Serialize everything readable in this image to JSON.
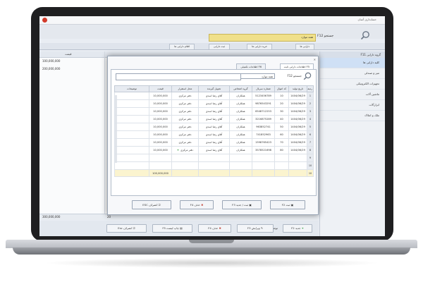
{
  "app": {
    "title": "حسابداری آسان"
  },
  "toolbar": {
    "search_label": "جستجو F12",
    "search_value": "همه موارد"
  },
  "main_tabs": [
    "اقلام دارایی ها",
    "ثبت دارایی",
    "خرید دارایی ها",
    "دارایی ها"
  ],
  "sidebar": {
    "header": "گروه دارایی F11",
    "items": [
      "کلیه دارایی ها",
      "میز و صندلی",
      "تجهیزات الکترونیکی",
      "ماشین آلات",
      "ابزارآلات",
      "ملک و املاک"
    ]
  },
  "background_grid": {
    "price_header": "قیمت",
    "values": [
      "100,000,000",
      "200,000,000"
    ],
    "total": "300,000,000",
    "total_count": "20",
    "description_label": "توضیحات :"
  },
  "background_buttons": {
    "new": "جدید F2",
    "edit": "ویرایش F3",
    "delete": "حذف F4",
    "print": "چاپ لیست F5",
    "cancel": "انصراف Esc"
  },
  "dialog": {
    "tabs": [
      "F5 اطلاعات دارایی ثابت",
      "F6 اطلاعات تکمیلی"
    ],
    "search_label": "جستجو F12",
    "search_scope": "همه موارد",
    "columns": [
      "ردیف",
      "تاریخ تولید",
      "کد اموال",
      "شماره سریال",
      "گروه اشخاص",
      "تحویل گیرنده",
      "محل استقرار",
      "قیمت",
      "توضیحات"
    ],
    "rows": [
      {
        "num": "1",
        "date": "1404/06/29",
        "code": "10",
        "serial": "5123456789",
        "group": "همکاران",
        "receiver": "آقای رضا اسدی",
        "location": "دفتر مرکزی",
        "price": "10,000,000",
        "desc": ""
      },
      {
        "num": "2",
        "date": "1404/06/29",
        "code": "20",
        "serial": "9876543291",
        "group": "همکاران",
        "receiver": "آقای رضا اسدی",
        "location": "دفتر مرکزی",
        "price": "10,000,000",
        "desc": ""
      },
      {
        "num": "3",
        "date": "1404/06/29",
        "code": "30",
        "serial": "6548712253",
        "group": "همکاران",
        "receiver": "آقای رضا اسدی",
        "location": "دفتر مرکزی",
        "price": "10,000,000",
        "desc": ""
      },
      {
        "num": "4",
        "date": "1404/06/29",
        "code": "40",
        "serial": "3216875289",
        "group": "همکاران",
        "receiver": "آقای رضا اسدی",
        "location": "دفتر مرکزی",
        "price": "10,000,000",
        "desc": ""
      },
      {
        "num": "5",
        "date": "1404/06/29",
        "code": "50",
        "serial": "963852741",
        "group": "همکاران",
        "receiver": "آقای رضا اسدی",
        "location": "دفتر مرکزی",
        "price": "10,000,000",
        "desc": ""
      },
      {
        "num": "6",
        "date": "1404/06/29",
        "code": "60",
        "serial": "741852963",
        "group": "همکاران",
        "receiver": "آقای رضا اسدی",
        "location": "دفتر مرکزی",
        "price": "10,000,000",
        "desc": ""
      },
      {
        "num": "7",
        "date": "1404/06/29",
        "code": "70",
        "serial": "1598765423",
        "group": "همکاران",
        "receiver": "آقای رضا اسدی",
        "location": "دفتر مرکزی",
        "price": "10,000,000",
        "desc": ""
      },
      {
        "num": "8",
        "date": "1404/06/29",
        "code": "80",
        "serial": "3578521698",
        "group": "همکاران",
        "receiver": "آقای رضا اسدی",
        "location": "دفتر مرکزی",
        "price": "10,000,000",
        "desc": ""
      },
      {
        "num": "9",
        "date": "",
        "code": "",
        "serial": "",
        "group": "",
        "receiver": "",
        "location": "",
        "price": "",
        "desc": ""
      },
      {
        "num": "10",
        "date": "",
        "code": "",
        "serial": "",
        "group": "",
        "receiver": "",
        "location": "",
        "price": "",
        "desc": ""
      }
    ],
    "total": {
      "count": "10",
      "price": "100,000,000"
    },
    "buttons": {
      "save": "ثبت F2",
      "save_new": "ثبت / جدید F3",
      "delete": "حذف F4",
      "cancel": "انصراف ESC"
    }
  }
}
